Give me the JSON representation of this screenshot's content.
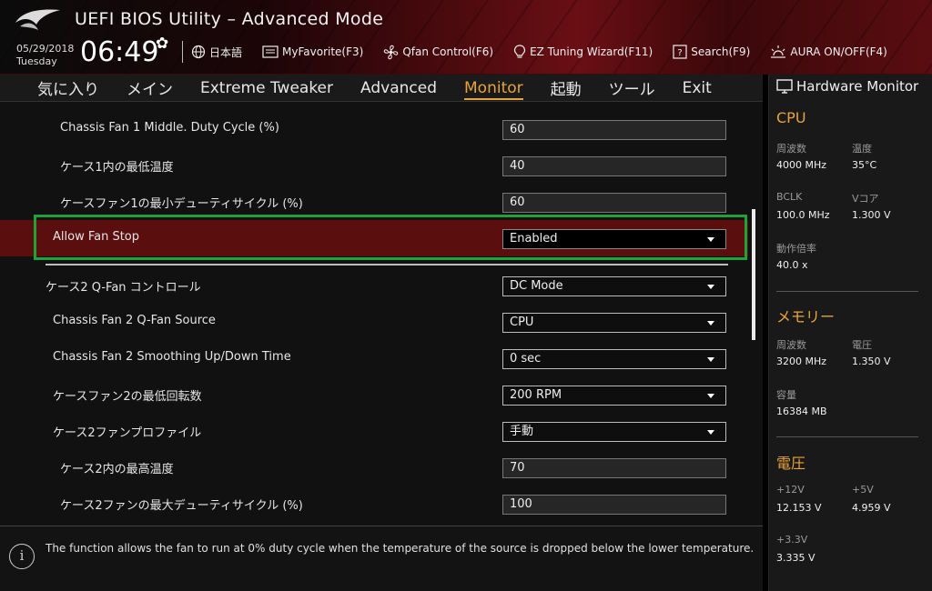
{
  "header": {
    "app_title": "UEFI BIOS Utility – Advanced Mode",
    "date": "05/29/2018",
    "day": "Tuesday",
    "time": "06:49",
    "toolbar": [
      {
        "label": "日本語",
        "icon": "globe-icon"
      },
      {
        "label": "MyFavorite(F3)",
        "icon": "favorite-icon"
      },
      {
        "label": "Qfan Control(F6)",
        "icon": "fan-icon"
      },
      {
        "label": "EZ Tuning Wizard(F11)",
        "icon": "bulb-icon"
      },
      {
        "label": "Search(F9)",
        "icon": "search-icon"
      },
      {
        "label": "AURA ON/OFF(F4)",
        "icon": "aura-icon"
      }
    ]
  },
  "nav": {
    "tabs": [
      "気に入り",
      "メイン",
      "Extreme Tweaker",
      "Advanced",
      "Monitor",
      "起動",
      "ツール",
      "Exit"
    ],
    "active": "Monitor"
  },
  "settings": [
    {
      "label": "Chassis Fan 1 Middle. Duty Cycle (%)",
      "value": "60",
      "type": "input"
    },
    {
      "label": "ケース1内の最低温度",
      "value": "40",
      "type": "input"
    },
    {
      "label": "ケースファン1の最小デューティサイクル (%)",
      "value": "60",
      "type": "input"
    },
    {
      "label": "Allow Fan Stop",
      "value": "Enabled",
      "type": "dropdown"
    },
    {
      "label": "ケース2 Q-Fan コントロール",
      "value": "DC Mode",
      "type": "dropdown"
    },
    {
      "label": "Chassis Fan 2 Q-Fan Source",
      "value": "CPU",
      "type": "dropdown"
    },
    {
      "label": "Chassis Fan 2 Smoothing Up/Down Time",
      "value": "0 sec",
      "type": "dropdown"
    },
    {
      "label": "ケースファン2の最低回転数",
      "value": "200 RPM",
      "type": "dropdown"
    },
    {
      "label": "ケース2ファンプロファイル",
      "value": "手動",
      "type": "dropdown"
    },
    {
      "label": "ケース2内の最高温度",
      "value": "70",
      "type": "input"
    },
    {
      "label": "ケース2ファンの最大デューティサイクル (%)",
      "value": "100",
      "type": "input"
    }
  ],
  "info": {
    "text": "The function allows the fan to run at 0% duty cycle when the temperature of the source is dropped below the lower temperature."
  },
  "monitor": {
    "title": "Hardware Monitor",
    "cpu": {
      "heading": "CPU",
      "freq_label": "周波数",
      "freq": "4000 MHz",
      "temp_label": "温度",
      "temp": "35°C",
      "bclk_label": "BCLK",
      "bclk": "100.0 MHz",
      "vcore_label": "Vコア",
      "vcore": "1.300 V",
      "ratio_label": "動作倍率",
      "ratio": "40.0 x"
    },
    "memory": {
      "heading": "メモリー",
      "freq_label": "周波数",
      "freq": "3200 MHz",
      "volt_label": "電圧",
      "volt": "1.350 V",
      "cap_label": "容量",
      "cap": "16384 MB"
    },
    "voltage": {
      "heading": "電圧",
      "v12_label": "+12V",
      "v12": "12.153 V",
      "v5_label": "+5V",
      "v5": "4.959 V",
      "v33_label": "+3.3V",
      "v33": "3.335 V"
    }
  },
  "colors": {
    "accent": "#e8a33c",
    "highlight_row": "#5b0e0e",
    "selection_box": "#1fa339"
  }
}
